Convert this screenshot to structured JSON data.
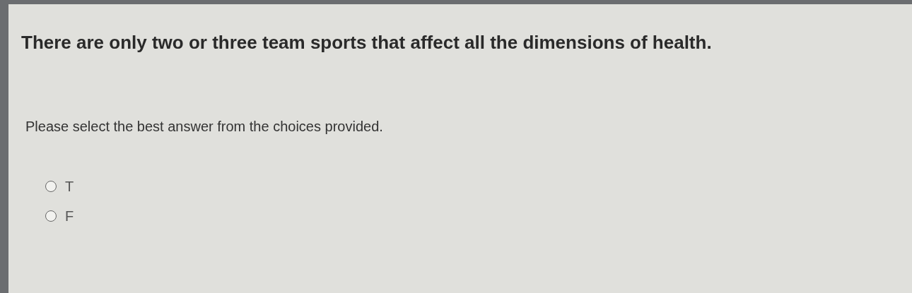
{
  "question": "There are only two or three team sports that affect all the dimensions of health.",
  "instruction": "Please select the best answer from the choices provided.",
  "choices": [
    {
      "label": "T",
      "selected": false
    },
    {
      "label": "F",
      "selected": false
    }
  ]
}
